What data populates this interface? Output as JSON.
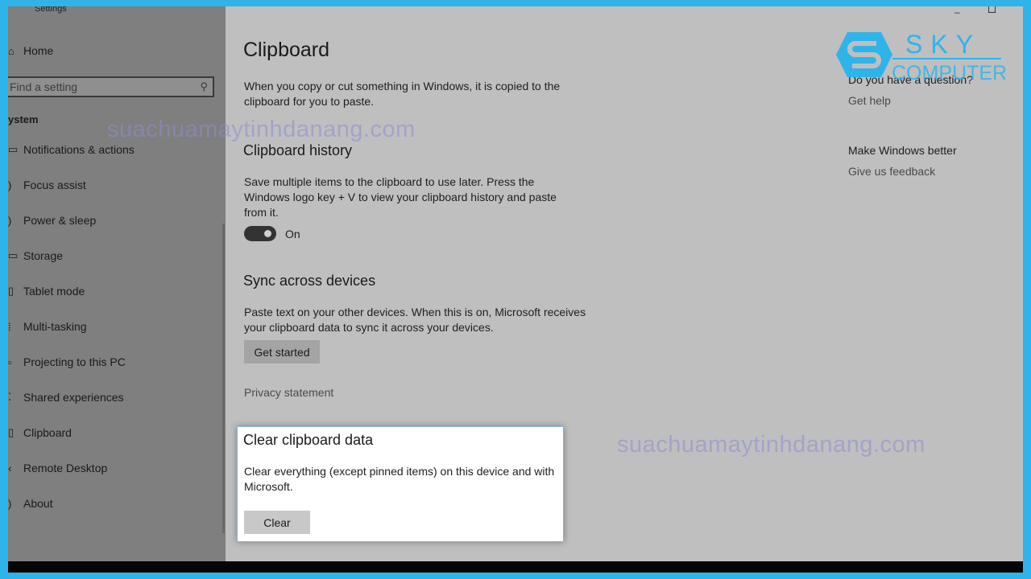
{
  "window": {
    "title": "Settings",
    "controls": [
      "minimize",
      "maximize"
    ]
  },
  "sidebar": {
    "home": "Home",
    "search_placeholder": "Find a setting",
    "section": "ystem",
    "items": [
      {
        "label": "Notifications & actions",
        "icon": "notification-icon"
      },
      {
        "label": "Focus assist",
        "icon": "moon-icon"
      },
      {
        "label": "Power & sleep",
        "icon": "power-icon"
      },
      {
        "label": "Storage",
        "icon": "storage-icon"
      },
      {
        "label": "Tablet mode",
        "icon": "tablet-icon"
      },
      {
        "label": "Multi-tasking",
        "icon": "multitasking-icon"
      },
      {
        "label": "Projecting to this PC",
        "icon": "projector-icon"
      },
      {
        "label": "Shared experiences",
        "icon": "shared-icon"
      },
      {
        "label": "Clipboard",
        "icon": "clipboard-icon"
      },
      {
        "label": "Remote Desktop",
        "icon": "remote-icon"
      },
      {
        "label": "About",
        "icon": "info-icon"
      }
    ]
  },
  "main": {
    "title": "Clipboard",
    "intro": "When you copy or cut something in Windows, it is copied to the clipboard for you to paste.",
    "history": {
      "heading": "Clipboard history",
      "desc": "Save multiple items to the clipboard to use later. Press the Windows logo key + V to view your clipboard history and paste from it.",
      "toggle_state": "On",
      "toggle_on": true
    },
    "sync": {
      "heading": "Sync across devices",
      "desc": "Paste text on your other devices. When this is on, Microsoft receives your clipboard data to sync it across your devices.",
      "button": "Get started"
    },
    "privacy": "Privacy statement",
    "clear": {
      "heading": "Clear clipboard data",
      "desc": "Clear everything (except pinned items) on this device and with Microsoft.",
      "button": "Clear"
    }
  },
  "aside": {
    "question": "Do you have a question?",
    "help": "Get help",
    "better": "Make Windows better",
    "feedback": "Give us feedback"
  },
  "watermarks": [
    "suachuamaytinhdanang.com",
    "suachuamaytinhdanang.com"
  ],
  "logo": {
    "line1": "SKY",
    "line2": "COMPUTER",
    "color": "#2fb4ea"
  },
  "colors": {
    "frame": "#2fb4ea",
    "sidebar": "#7f7f7f",
    "content": "#bfbfbf"
  }
}
